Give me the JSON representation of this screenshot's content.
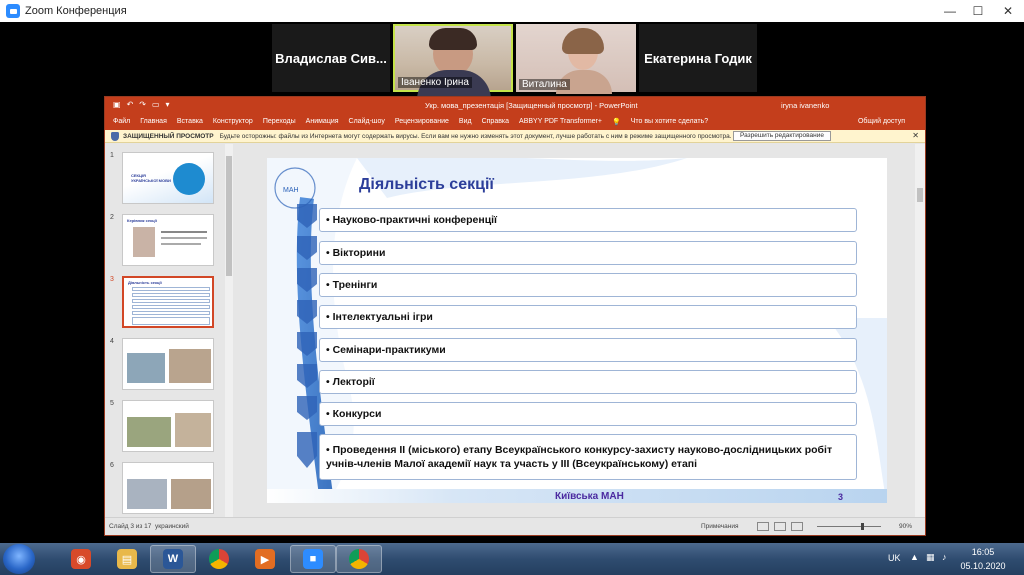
{
  "zoom": {
    "title": "Zoom Конференция",
    "participants": [
      {
        "name": "Владислав  Сив..."
      },
      {
        "name": "Іваненко Ірина"
      },
      {
        "name": "Виталина"
      },
      {
        "name": "Екатерина Годик"
      }
    ]
  },
  "powerpoint": {
    "doc_title": "Укр. мова_презентація [Защищенный просмотр]  -  PowerPoint",
    "user": "iryna ivanenko",
    "ribbon_tabs": [
      "Файл",
      "Главная",
      "Вставка",
      "Конструктор",
      "Переходы",
      "Анимация",
      "Слайд-шоу",
      "Рецензирование",
      "Вид",
      "Справка",
      "ABBYY PDF Transformer+",
      "Что вы хотите сделать?"
    ],
    "share": "Общий доступ",
    "protected": {
      "label": "ЗАЩИЩЕННЫЙ ПРОСМОТР",
      "message": "Будьте осторожны: файлы из Интернета могут содержать вирусы. Если вам не нужно изменять этот документ, лучше работать с ним в режиме защищенного просмотра.",
      "button": "Разрешить редактирование"
    },
    "thumbnails": [
      {
        "num": "1",
        "caption": "СЕКЦІЯ УКРАЇНСЬКОЇ МОВИ"
      },
      {
        "num": "2",
        "caption": "Керівник секції"
      },
      {
        "num": "3",
        "caption": "Діяльність секції"
      },
      {
        "num": "4",
        "caption": ""
      },
      {
        "num": "5",
        "caption": ""
      },
      {
        "num": "6",
        "caption": ""
      }
    ],
    "slide": {
      "title": "Діяльність секції",
      "items": [
        "• Науково-практичні конференції",
        "• Вікторини",
        "• Тренінги",
        "• Інтелектуальні ігри",
        "• Семінари-практикуми",
        "• Лекторії",
        "• Конкурси",
        "• Проведення ІІ (міського) етапу Всеукраїнського конкурсу-захисту науково-дослідницьких робіт учнів-членів Малої академії наук та участь у ІІІ (Всеукраїнському) етапі"
      ],
      "footer": "Київська МАН",
      "page": "3"
    },
    "status": {
      "slide_of": "Слайд 3 из 17",
      "language": "украинский",
      "notes": "Примечания",
      "zoom": "90%"
    }
  },
  "taskbar": {
    "apps": [
      "start-orb",
      "eye-app",
      "folder",
      "word",
      "chrome",
      "media",
      "zoom",
      "chrome-2"
    ],
    "language": "UK",
    "time": "16:05",
    "date": "05.10.2020"
  }
}
